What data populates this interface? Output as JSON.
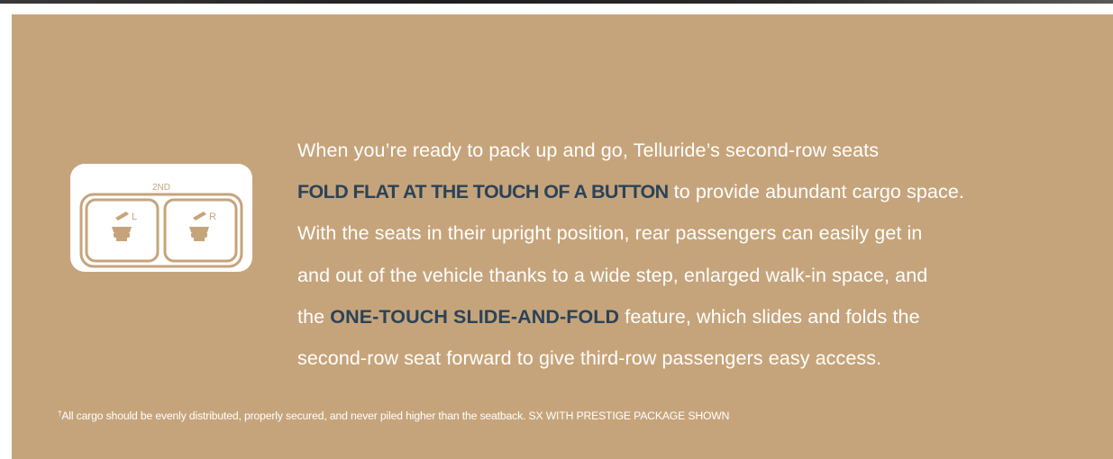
{
  "icon": {
    "name": "second-row-fold-buttons-icon",
    "label": "2ND",
    "left_marker": "L",
    "right_marker": "R"
  },
  "body": {
    "line1": "When you’re ready to pack up and go, Telluride’s second-row seats",
    "line2_highlight": "FOLD FLAT AT THE TOUCH OF A BUTTON",
    "line2_rest": " to provide abundant cargo space.",
    "line3": "With the seats in their upright position, rear passengers can easily get in",
    "line4": "and out of the vehicle thanks to a wide step, enlarged walk-in space, and",
    "line5_start": "the ",
    "line5_highlight": "ONE-TOUCH SLIDE-AND-FOLD",
    "line5_rest": " feature, which slides and folds the",
    "line6": "second-row seat forward to give third-row passengers easy access."
  },
  "footnote": {
    "marker": "†",
    "text": "All cargo should be evenly distributed, properly secured, and never piled higher than the seatback. SX WITH PRESTIGE PACKAGE SHOWN"
  },
  "colors": {
    "panel": "#c6a47b",
    "highlight": "#2a4358",
    "text": "#ffffff"
  }
}
